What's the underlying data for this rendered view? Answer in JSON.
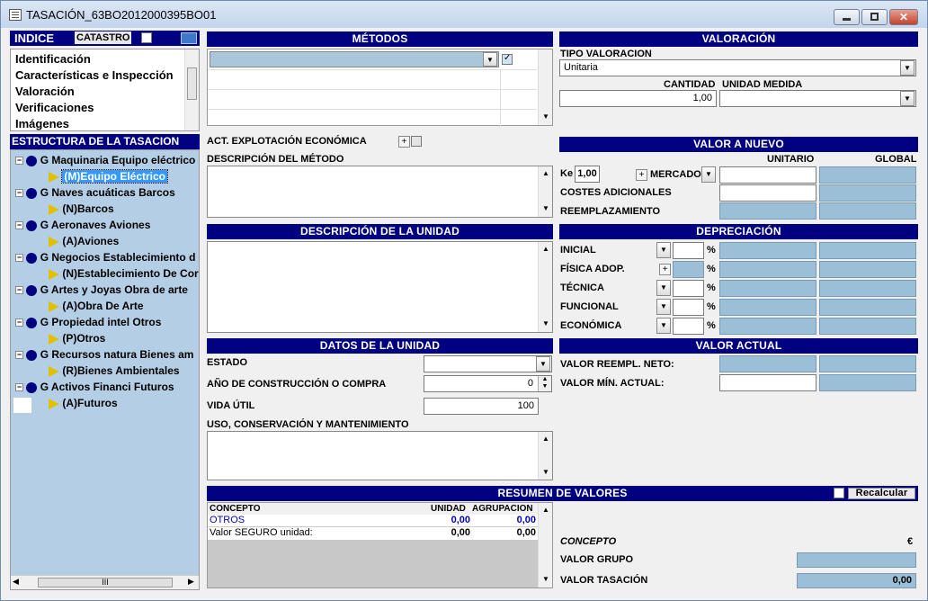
{
  "window": {
    "title": "TASACIÓN_63BO2012000395BO01"
  },
  "left": {
    "indice_label": "INDICE",
    "catastro_label": "CATASTRO",
    "index_items": [
      "Identificación",
      "Características e Inspección",
      "Valoración",
      "Verificaciones",
      "Imágenes"
    ],
    "estructura_title": "ESTRUCTURA DE LA TASACION",
    "tree": [
      {
        "group": "G Maquinaria Equipo eléctrico",
        "child": "(M)Equipo Eléctrico"
      },
      {
        "group": "G Naves acuáticas Barcos",
        "child": "(N)Barcos"
      },
      {
        "group": "G Aeronaves Aviones",
        "child": "(A)Aviones"
      },
      {
        "group": "G Negocios Establecimiento d",
        "child": "(N)Establecimiento De Cor"
      },
      {
        "group": "G Artes y Joyas Obra de arte",
        "child": "(A)Obra De Arte"
      },
      {
        "group": "G Propiedad intel Otros",
        "child": "(P)Otros"
      },
      {
        "group": "G Recursos natura Bienes am",
        "child": "(R)Bienes Ambientales"
      },
      {
        "group": "G Activos Financi Futuros",
        "child": "(A)Futuros"
      }
    ],
    "hscroll_thumb": "III"
  },
  "metodos": {
    "title": "MÉTODOS",
    "act_label": "ACT. EXPLOTACIÓN ECONÓMICA",
    "desc_label": "DESCRIPCIÓN DEL MÉTODO"
  },
  "unidad": {
    "title": "DESCRIPCIÓN DE LA UNIDAD"
  },
  "datos": {
    "title": "DATOS DE LA UNIDAD",
    "estado_label": "ESTADO",
    "anio_label": "AÑO DE CONSTRUCCIÓN O COMPRA",
    "anio_value": "0",
    "vida_label": "VIDA ÚTIL",
    "vida_value": "100",
    "uso_label": "USO, CONSERVACIÓN Y MANTENIMIENTO"
  },
  "valoracion": {
    "title": "VALORACIÓN",
    "tipo_label": "TIPO VALORACION",
    "tipo_value": "Unitaria",
    "cantidad_label": "CANTIDAD",
    "cantidad_value": "1,00",
    "unidad_label": "UNIDAD MEDIDA"
  },
  "valor_nuevo": {
    "title": "VALOR A NUEVO",
    "unitario": "UNITARIO",
    "global": "GLOBAL",
    "ke_label": "Ke",
    "ke_value": "1,00",
    "mercado_label": "MERCADO",
    "costes_label": "COSTES ADICIONALES",
    "reemplazamiento_label": "REEMPLAZAMIENTO"
  },
  "depreciacion": {
    "title": "DEPRECIACIÓN",
    "rows": [
      "INICIAL",
      "FÍSICA ADOP.",
      "TÉCNICA",
      "FUNCIONAL",
      "ECONÓMICA"
    ],
    "pct": "%"
  },
  "valor_actual": {
    "title": "VALOR ACTUAL",
    "reempl_label": "VALOR REEMPL. NETO:",
    "min_label": "VALOR MÍN. ACTUAL:"
  },
  "resumen": {
    "title": "RESUMEN DE VALORES",
    "recalcular": "Recalcular",
    "col_concepto": "CONCEPTO",
    "col_unidad": "UNIDAD",
    "col_agrup": "AGRUPACION",
    "rows": [
      {
        "concepto": "OTROS",
        "unidad": "0,00",
        "agrup": "0,00"
      },
      {
        "concepto": "Valor SEGURO unidad:",
        "unidad": "0,00",
        "agrup": "0,00"
      }
    ],
    "concepto_label": "CONCEPTO",
    "currency": "€",
    "grupo_label": "VALOR GRUPO",
    "tasacion_label": "VALOR TASACIÓN",
    "tasacion_value": "0,00"
  },
  "colors": {
    "header": "#000080",
    "field_blue": "#9cbfd8",
    "tree_bg": "#b4cfe5"
  }
}
